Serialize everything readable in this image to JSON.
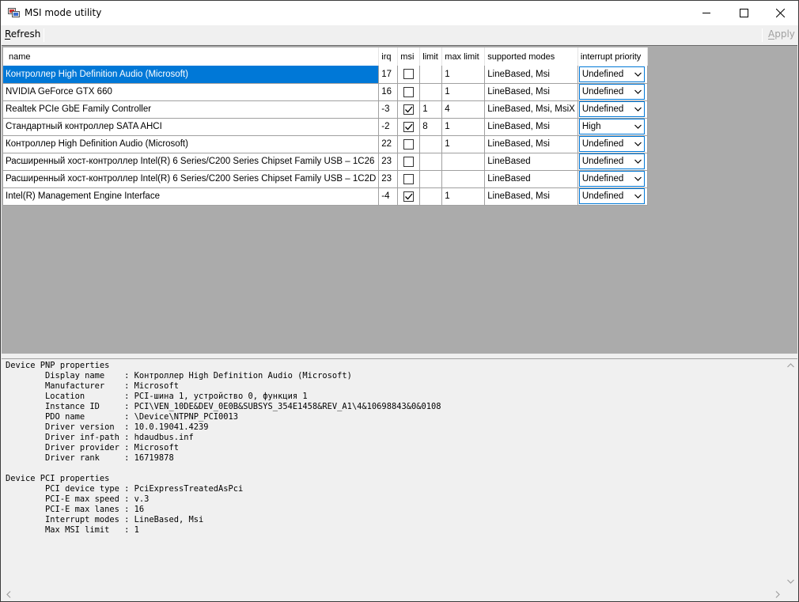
{
  "window": {
    "title": "MSI mode utility"
  },
  "toolbar": {
    "refresh_label": "Refresh",
    "apply_label": "Apply"
  },
  "grid": {
    "columns": [
      "name",
      "irq",
      "msi",
      "limit",
      "max limit",
      "supported modes",
      "interrupt priority"
    ],
    "rows": [
      {
        "name": "Контроллер High Definition Audio (Microsoft)",
        "irq": "17",
        "msi": false,
        "limit": "",
        "max_limit": "1",
        "modes": "LineBased, Msi",
        "priority": "Undefined"
      },
      {
        "name": "NVIDIA GeForce GTX 660",
        "irq": "16",
        "msi": false,
        "limit": "",
        "max_limit": "1",
        "modes": "LineBased, Msi",
        "priority": "Undefined"
      },
      {
        "name": "Realtek PCIe GbE Family Controller",
        "irq": "-3",
        "msi": true,
        "limit": "1",
        "max_limit": "4",
        "modes": "LineBased, Msi, MsiX",
        "priority": "Undefined"
      },
      {
        "name": "Стандартный контроллер SATA AHCI",
        "irq": "-2",
        "msi": true,
        "limit": "8",
        "max_limit": "1",
        "modes": "LineBased, Msi",
        "priority": "High"
      },
      {
        "name": "Контроллер High Definition Audio (Microsoft)",
        "irq": "22",
        "msi": false,
        "limit": "",
        "max_limit": "1",
        "modes": "LineBased, Msi",
        "priority": "Undefined"
      },
      {
        "name": "Расширенный хост-контроллер Intel(R) 6 Series/C200 Series Chipset Family USB – 1C26",
        "irq": "23",
        "msi": false,
        "limit": "",
        "max_limit": "",
        "modes": "LineBased",
        "priority": "Undefined"
      },
      {
        "name": "Расширенный хост-контроллер Intel(R) 6 Series/C200 Series Chipset Family USB – 1C2D",
        "irq": "23",
        "msi": false,
        "limit": "",
        "max_limit": "",
        "modes": "LineBased",
        "priority": "Undefined"
      },
      {
        "name": "Intel(R) Management Engine Interface",
        "irq": "-4",
        "msi": true,
        "limit": "",
        "max_limit": "1",
        "modes": "LineBased, Msi",
        "priority": "Undefined"
      }
    ]
  },
  "details": {
    "text": "Device PNP properties\n        Display name    : Контроллер High Definition Audio (Microsoft)\n        Manufacturer    : Microsoft\n        Location        : PCI-шина 1, устройство 0, функция 1\n        Instance ID     : PCI\\VEN_10DE&DEV_0E0B&SUBSYS_354E1458&REV_A1\\4&10698843&0&0108\n        PDO name        : \\Device\\NTPNP_PCI0013\n        Driver version  : 10.0.19041.4239\n        Driver inf-path : hdaudbus.inf\n        Driver provider : Microsoft\n        Driver rank     : 16719878\n\nDevice PCI properties\n        PCI device type : PciExpressTreatedAsPci\n        PCI-E max speed : v.3\n        PCI-E max lanes : 16\n        Interrupt modes : LineBased, Msi\n        Max MSI limit   : 1"
  },
  "colors": {
    "selection": "#0078d7",
    "grid_background": "#ababab",
    "window_background": "#f0f0f0"
  },
  "icons": [
    "app-icon",
    "minimize-icon",
    "maximize-icon",
    "close-icon",
    "checkbox-icon",
    "chevron-down-icon",
    "scroll-up-icon",
    "scroll-down-icon",
    "scroll-left-icon",
    "scroll-right-icon"
  ]
}
